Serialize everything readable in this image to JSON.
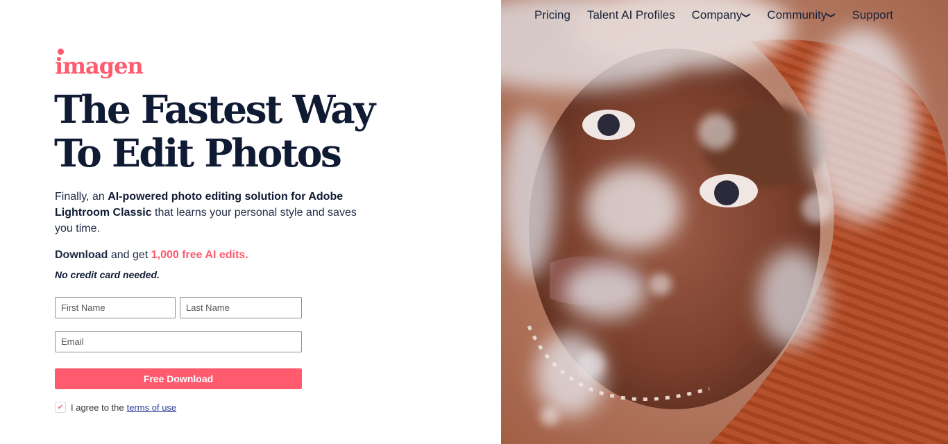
{
  "nav": {
    "items": [
      {
        "label": "Pricing",
        "dropdown": false
      },
      {
        "label": "Talent AI Profiles",
        "dropdown": false
      },
      {
        "label": "Company",
        "dropdown": true
      },
      {
        "label": "Community",
        "dropdown": true
      },
      {
        "label": "Support",
        "dropdown": false
      }
    ]
  },
  "brand": {
    "logo_text": "imagen",
    "accent_color": "#ff5a6e",
    "text_color": "#0f1a33"
  },
  "hero": {
    "headline_line1": "The Fastest Way",
    "headline_line2": "To Edit Photos",
    "lead_part1": "Finally, an ",
    "lead_bold1": "AI-powered photo editing solution for Adobe Lightroom Classic",
    "lead_part2": " that learns your personal style and saves you time.",
    "offer_bold": "Download",
    "offer_mid": " and get ",
    "offer_accent": "1,000 free AI edits.",
    "no_card": "No credit card needed."
  },
  "form": {
    "first_name_placeholder": "First Name",
    "last_name_placeholder": "Last Name",
    "email_placeholder": "Email",
    "submit_label": "Free Download",
    "agree_text": "I agree to the",
    "terms_link": "terms of use",
    "agree_checked": true
  }
}
